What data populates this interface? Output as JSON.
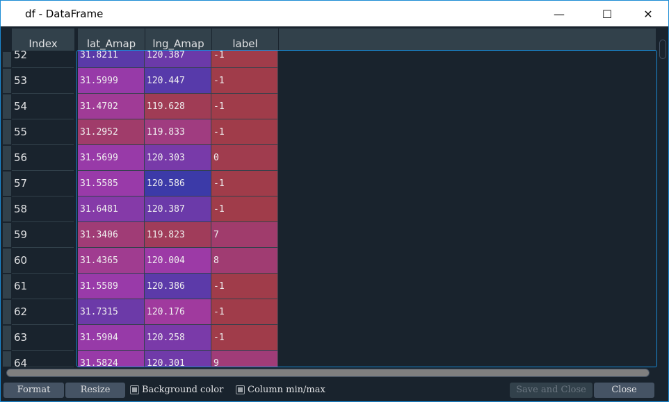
{
  "window": {
    "title": "df - DataFrame",
    "minimize": "—",
    "maximize": "☐",
    "close": "✕"
  },
  "columns": {
    "index": "Index",
    "headers": [
      "lat_Amap",
      "lng_Amap",
      "label"
    ]
  },
  "rows": [
    {
      "index": "52",
      "cells": [
        {
          "v": "31.8211",
          "c": "#5a3aa8"
        },
        {
          "v": "120.387",
          "c": "#6b3aa9"
        },
        {
          "v": "-1",
          "c": "#a03c4a"
        }
      ]
    },
    {
      "index": "53",
      "cells": [
        {
          "v": "31.5999",
          "c": "#973aa8"
        },
        {
          "v": "120.447",
          "c": "#573aaa"
        },
        {
          "v": "-1",
          "c": "#a03c4a"
        }
      ]
    },
    {
      "index": "54",
      "cells": [
        {
          "v": "31.4702",
          "c": "#a03b96"
        },
        {
          "v": "119.628",
          "c": "#a03c55"
        },
        {
          "v": "-1",
          "c": "#a03c4a"
        }
      ]
    },
    {
      "index": "55",
      "cells": [
        {
          "v": "31.2952",
          "c": "#a03c6a"
        },
        {
          "v": "119.833",
          "c": "#a03c80"
        },
        {
          "v": "-1",
          "c": "#a03c4a"
        }
      ]
    },
    {
      "index": "56",
      "cells": [
        {
          "v": "31.5699",
          "c": "#983aa8"
        },
        {
          "v": "120.303",
          "c": "#783aa9"
        },
        {
          "v": "0",
          "c": "#a03c4e"
        }
      ]
    },
    {
      "index": "57",
      "cells": [
        {
          "v": "31.5585",
          "c": "#993aa9"
        },
        {
          "v": "120.586",
          "c": "#3c3aa8"
        },
        {
          "v": "-1",
          "c": "#a03c4a"
        }
      ]
    },
    {
      "index": "58",
      "cells": [
        {
          "v": "31.6481",
          "c": "#853aa8"
        },
        {
          "v": "120.387",
          "c": "#6b3aa9"
        },
        {
          "v": "-1",
          "c": "#a03c4a"
        }
      ]
    },
    {
      "index": "59",
      "cells": [
        {
          "v": "31.3406",
          "c": "#a03c76"
        },
        {
          "v": "119.823",
          "c": "#a03c5a"
        },
        {
          "v": "7",
          "c": "#a03c6c"
        }
      ]
    },
    {
      "index": "60",
      "cells": [
        {
          "v": "31.4365",
          "c": "#a03c90"
        },
        {
          "v": "120.004",
          "c": "#9c3aa6"
        },
        {
          "v": "8",
          "c": "#a03c72"
        }
      ]
    },
    {
      "index": "61",
      "cells": [
        {
          "v": "31.5589",
          "c": "#993aa9"
        },
        {
          "v": "120.386",
          "c": "#5c3aa9"
        },
        {
          "v": "-1",
          "c": "#a03c4a"
        }
      ]
    },
    {
      "index": "62",
      "cells": [
        {
          "v": "31.7315",
          "c": "#6c3aa8"
        },
        {
          "v": "120.176",
          "c": "#a03a9e"
        },
        {
          "v": "-1",
          "c": "#a03c4a"
        }
      ]
    },
    {
      "index": "63",
      "cells": [
        {
          "v": "31.5904",
          "c": "#973aa8"
        },
        {
          "v": "120.258",
          "c": "#7a3aa9"
        },
        {
          "v": "-1",
          "c": "#a03c4a"
        }
      ]
    },
    {
      "index": "64",
      "cells": [
        {
          "v": "31.5824",
          "c": "#983aa8"
        },
        {
          "v": "120.301",
          "c": "#703aa9"
        },
        {
          "v": "9",
          "c": "#a03c78"
        }
      ]
    }
  ],
  "footer": {
    "format": "Format",
    "resize": "Resize",
    "background_color": "Background color",
    "column_minmax": "Column min/max",
    "save_close": "Save and Close",
    "close": "Close"
  }
}
